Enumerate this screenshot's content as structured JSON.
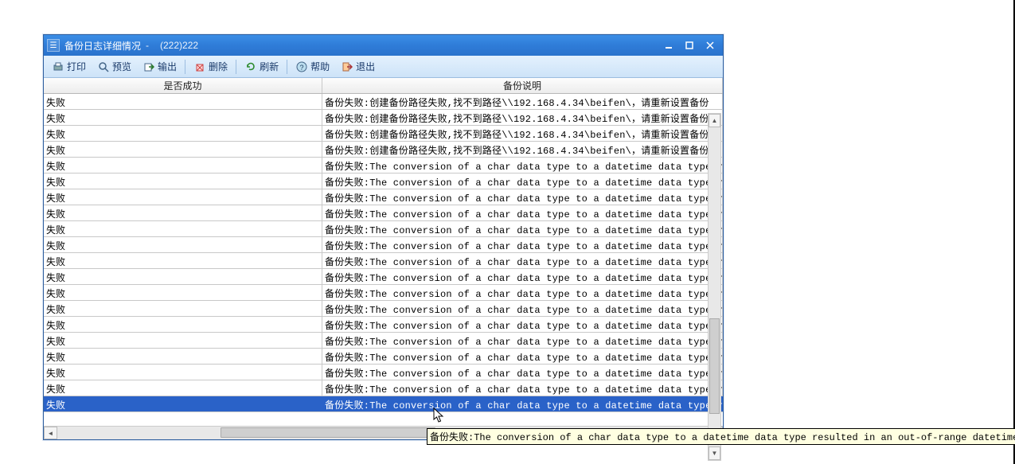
{
  "window": {
    "title": "备份日志详细情况",
    "sep": "-",
    "subtitle": "(222)222"
  },
  "toolbar": {
    "print": "打印",
    "preview": "预览",
    "export": "输出",
    "delete": "删除",
    "refresh": "刷新",
    "help": "帮助",
    "exit": "退出"
  },
  "grid": {
    "headers": {
      "col0": "是否成功",
      "col1": "备份说明"
    },
    "rows": [
      {
        "status": "失败",
        "msg": "备份失败:创建备份路径失败,找不到路径\\\\192.168.4.34\\beifen\\，请重新设置备份"
      },
      {
        "status": "失败",
        "msg": "备份失败:创建备份路径失败,找不到路径\\\\192.168.4.34\\beifen\\，请重新设置备份"
      },
      {
        "status": "失败",
        "msg": "备份失败:创建备份路径失败,找不到路径\\\\192.168.4.34\\beifen\\，请重新设置备份"
      },
      {
        "status": "失败",
        "msg": "备份失败:创建备份路径失败,找不到路径\\\\192.168.4.34\\beifen\\，请重新设置备份"
      },
      {
        "status": "失败",
        "msg": "备份失败:The conversion of a char data type to a datetime data type resul"
      },
      {
        "status": "失败",
        "msg": "备份失败:The conversion of a char data type to a datetime data type resul"
      },
      {
        "status": "失败",
        "msg": "备份失败:The conversion of a char data type to a datetime data type resul"
      },
      {
        "status": "失败",
        "msg": "备份失败:The conversion of a char data type to a datetime data type resul"
      },
      {
        "status": "失败",
        "msg": "备份失败:The conversion of a char data type to a datetime data type resul"
      },
      {
        "status": "失败",
        "msg": "备份失败:The conversion of a char data type to a datetime data type resul"
      },
      {
        "status": "失败",
        "msg": "备份失败:The conversion of a char data type to a datetime data type resul"
      },
      {
        "status": "失败",
        "msg": "备份失败:The conversion of a char data type to a datetime data type resul"
      },
      {
        "status": "失败",
        "msg": "备份失败:The conversion of a char data type to a datetime data type resul"
      },
      {
        "status": "失败",
        "msg": "备份失败:The conversion of a char data type to a datetime data type resul"
      },
      {
        "status": "失败",
        "msg": "备份失败:The conversion of a char data type to a datetime data type resul"
      },
      {
        "status": "失败",
        "msg": "备份失败:The conversion of a char data type to a datetime data type resul"
      },
      {
        "status": "失败",
        "msg": "备份失败:The conversion of a char data type to a datetime data type resul"
      },
      {
        "status": "失败",
        "msg": "备份失败:The conversion of a char data type to a datetime data type resul"
      },
      {
        "status": "失败",
        "msg": "备份失败:The conversion of a char data type to a datetime data type resul"
      },
      {
        "status": "失败",
        "msg": "备份失败:The conversion of a char data type to a datetime data type resul",
        "selected": true
      }
    ]
  },
  "tooltip": "备份失败:The conversion of a char data type to a datetime data type resulted in an out-of-range datetime value."
}
